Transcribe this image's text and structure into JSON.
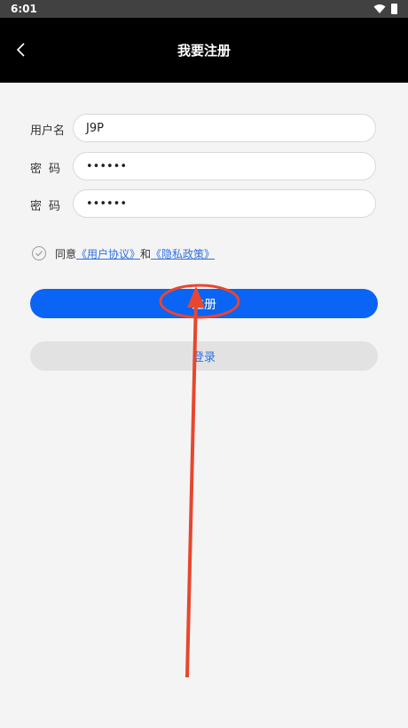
{
  "status_bar": {
    "time": "6:01"
  },
  "header": {
    "title": "我要注册"
  },
  "form": {
    "username_label": "用户名",
    "username_value": "J9P",
    "password_label": "密码",
    "password_value": "••••••",
    "confirm_label": "密码",
    "confirm_value": "••••••"
  },
  "agreement": {
    "prefix": "同意",
    "user_agreement": "《用户协议》",
    "and": "和",
    "privacy_policy": "《隐私政策》"
  },
  "buttons": {
    "register_label": "注册",
    "login_label": "登录"
  },
  "colors": {
    "accent": "#0a64f5",
    "header_bg": "#000000",
    "annotation": "#e8462f"
  }
}
